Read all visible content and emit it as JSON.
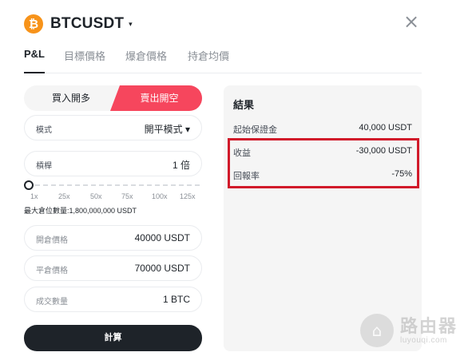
{
  "header": {
    "coin_glyph": "₿",
    "symbol": "BTCUSDT",
    "caret": "▾",
    "close": "×"
  },
  "tabs": [
    "P&L",
    "目標價格",
    "爆倉價格",
    "持倉均價"
  ],
  "side": {
    "buy": "買入開多",
    "sell": "賣出開空",
    "sell_color": "#f6465d"
  },
  "mode": {
    "label": "模式",
    "value": "開平模式 ▾"
  },
  "leverage": {
    "label": "槓桿",
    "value": "1 倍",
    "level": 1,
    "ticks": [
      "1x",
      "25x",
      "50x",
      "75x",
      "100x",
      "125x"
    ]
  },
  "max_position": "最大倉位數量:1,800,000,000 USDT",
  "entry_price": {
    "label": "開倉價格",
    "value": "40000 USDT"
  },
  "exit_price": {
    "label": "平倉價格",
    "value": "70000 USDT"
  },
  "quantity": {
    "label": "成交數量",
    "value": "1 BTC"
  },
  "calculate": "計算",
  "result": {
    "title": "結果",
    "initial_margin": {
      "label": "起始保證金",
      "value": "40,000 USDT"
    },
    "pnl": {
      "label": "收益",
      "value": "-30,000 USDT"
    },
    "roe": {
      "label": "回報率",
      "value": "-75%"
    },
    "highlight_color": "#d11a2a"
  },
  "watermark": {
    "icon": "wifi-lock-icon",
    "cn": "路由器",
    "en": "luyouqi.com"
  }
}
